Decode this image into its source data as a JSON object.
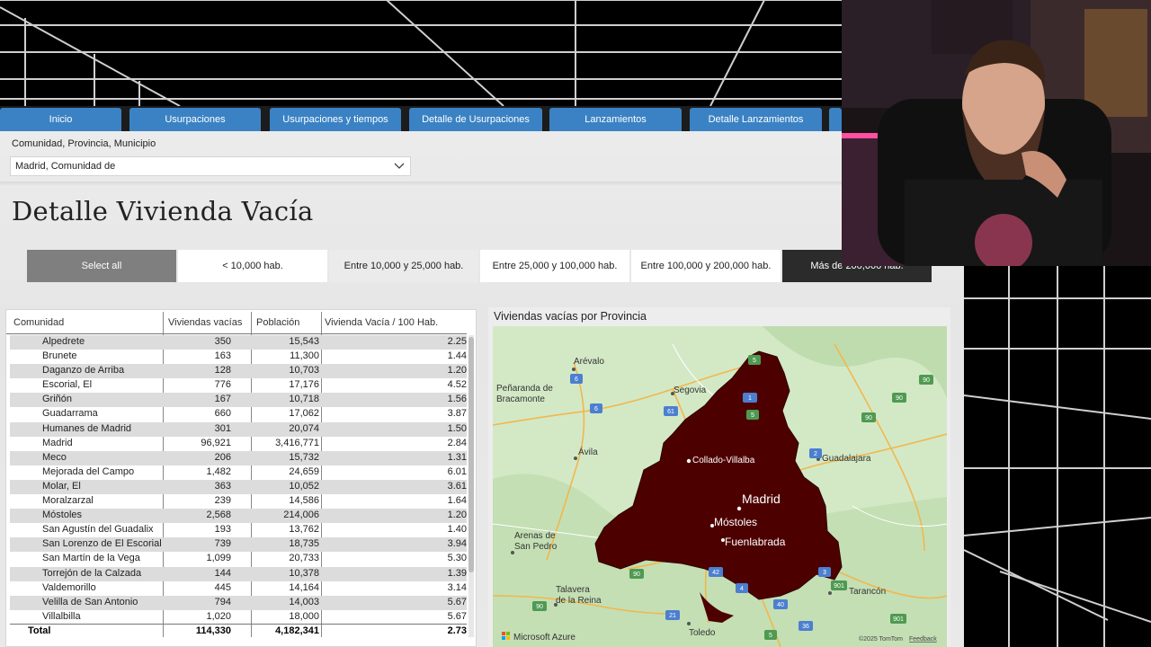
{
  "tabs": [
    {
      "label": "Inicio"
    },
    {
      "label": "Usurpaciones"
    },
    {
      "label": "Usurpaciones y tiempos"
    },
    {
      "label": "Detalle de Usurpaciones"
    },
    {
      "label": "Lanzamientos"
    },
    {
      "label": "Detalle Lanzamientos"
    }
  ],
  "filter": {
    "label": "Comunidad, Provincia, Municipio",
    "value": "Madrid, Comunidad de"
  },
  "page_title": "Detalle Vivienda Vacía",
  "segments": [
    {
      "label": "Select all",
      "state": "selected"
    },
    {
      "label": "< 10,000 hab.",
      "state": "normal"
    },
    {
      "label": "Entre 10,000 y 25,000 hab.",
      "state": "hover"
    },
    {
      "label": "Entre 25,000 y 100,000 hab.",
      "state": "normal"
    },
    {
      "label": "Entre 100,000 y 200,000 hab.",
      "state": "normal"
    },
    {
      "label": "Más de 200,000 hab.",
      "state": "dark"
    }
  ],
  "table": {
    "headers": {
      "comunidad": "Comunidad",
      "viviendas": "Viviendas vacías",
      "poblacion": "Población",
      "ratio": "Vivienda Vacía / 100 Hab."
    },
    "rows": [
      {
        "name": "Alpedrete",
        "viv": "350",
        "pob": "15,543",
        "ratio": "2.25"
      },
      {
        "name": "Brunete",
        "viv": "163",
        "pob": "11,300",
        "ratio": "1.44"
      },
      {
        "name": "Daganzo de Arriba",
        "viv": "128",
        "pob": "10,703",
        "ratio": "1.20"
      },
      {
        "name": "Escorial, El",
        "viv": "776",
        "pob": "17,176",
        "ratio": "4.52"
      },
      {
        "name": "Griñón",
        "viv": "167",
        "pob": "10,718",
        "ratio": "1.56"
      },
      {
        "name": "Guadarrama",
        "viv": "660",
        "pob": "17,062",
        "ratio": "3.87"
      },
      {
        "name": "Humanes de Madrid",
        "viv": "301",
        "pob": "20,074",
        "ratio": "1.50"
      },
      {
        "name": "Madrid",
        "viv": "96,921",
        "pob": "3,416,771",
        "ratio": "2.84"
      },
      {
        "name": "Meco",
        "viv": "206",
        "pob": "15,732",
        "ratio": "1.31"
      },
      {
        "name": "Mejorada del Campo",
        "viv": "1,482",
        "pob": "24,659",
        "ratio": "6.01"
      },
      {
        "name": "Molar, El",
        "viv": "363",
        "pob": "10,052",
        "ratio": "3.61"
      },
      {
        "name": "Moralzarzal",
        "viv": "239",
        "pob": "14,586",
        "ratio": "1.64"
      },
      {
        "name": "Móstoles",
        "viv": "2,568",
        "pob": "214,006",
        "ratio": "1.20"
      },
      {
        "name": "San Agustín del Guadalix",
        "viv": "193",
        "pob": "13,762",
        "ratio": "1.40"
      },
      {
        "name": "San Lorenzo de El Escorial",
        "viv": "739",
        "pob": "18,735",
        "ratio": "3.94"
      },
      {
        "name": "San Martín de la Vega",
        "viv": "1,099",
        "pob": "20,733",
        "ratio": "5.30"
      },
      {
        "name": "Torrejón de la Calzada",
        "viv": "144",
        "pob": "10,378",
        "ratio": "1.39"
      },
      {
        "name": "Valdemorillo",
        "viv": "445",
        "pob": "14,164",
        "ratio": "3.14"
      },
      {
        "name": "Velilla de San Antonio",
        "viv": "794",
        "pob": "14,003",
        "ratio": "5.67"
      },
      {
        "name": "Villalbilla",
        "viv": "1,020",
        "pob": "18,000",
        "ratio": "5.67"
      }
    ],
    "total": {
      "name": "Total",
      "viv": "114,330",
      "pob": "4,182,341",
      "ratio": "2.73"
    }
  },
  "map": {
    "title": "Viviendas vacías por Provincia",
    "region_color": "#4d0000",
    "labels": {
      "arevalo": "Arévalo",
      "penaranda": "Peñaranda de",
      "bracamonte": "Bracamonte",
      "segovia": "Segovia",
      "avila": "Ávila",
      "collado": "Collado-Villalba",
      "guadalajara": "Guadalajara",
      "madrid": "Madrid",
      "mostoles": "Móstoles",
      "fuenlabrada": "Fuenlabrada",
      "arenas1": "Arenas de",
      "arenas2": "San Pedro",
      "talavera1": "Talavera",
      "talavera2": "de la Reina",
      "toledo": "Toledo",
      "tarancon": "Tarancón"
    },
    "shields": {
      "s5a": "5",
      "s1": "1",
      "s5b": "5",
      "s6a": "6",
      "s6b": "6",
      "s61": "61",
      "s90a": "90",
      "s90b": "90",
      "s90c": "90",
      "s2": "2",
      "s3": "3",
      "s901a": "901",
      "s42": "42",
      "s4": "4",
      "s40": "40",
      "s90d": "90",
      "s21": "21",
      "s36": "36",
      "s901b": "901",
      "s5c": "5",
      "s90e": "90"
    },
    "attribution": "Microsoft Azure",
    "copyright": "©2025 TomTom",
    "feedback": "Feedback"
  }
}
